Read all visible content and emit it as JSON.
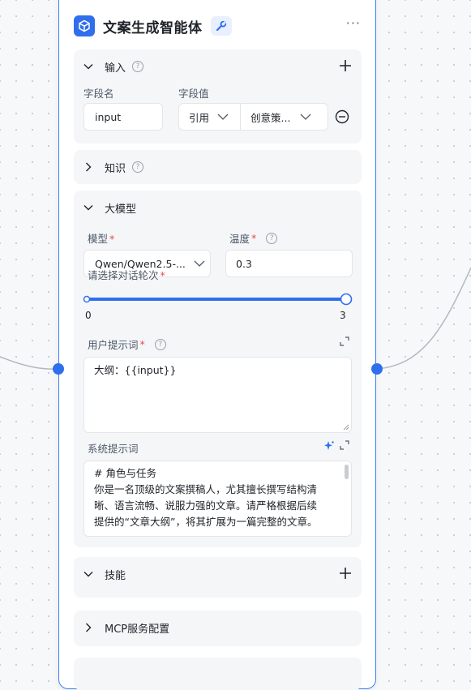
{
  "node": {
    "title": "文案生成智能体",
    "more_label": "···"
  },
  "input_section": {
    "title": "输入",
    "field_name_header": "字段名",
    "field_value_header": "字段值",
    "field_name_value": "input",
    "ref_type": "引用",
    "ref_value": "创意策..."
  },
  "knowledge_section": {
    "title": "知识"
  },
  "model_section": {
    "title": "大模型",
    "model_label": "模型",
    "model_value": "Qwen/Qwen2.5-...",
    "temperature_label": "温度",
    "temperature_value": "0.3",
    "rounds_label": "请选择对话轮次",
    "rounds_min": "0",
    "rounds_max": "3",
    "rounds_value": 3,
    "user_prompt_label": "用户提示词",
    "user_prompt_value": "大纲：{{input}}",
    "system_prompt_label": "系统提示词",
    "system_prompt_lines": [
      "# 角色与任务",
      "你是一名顶级的文案撰稿人，尤其擅长撰写结构清",
      "晰、语言流畅、说服力强的文章。请严格根据后续",
      "提供的“文章大纲”，将其扩展为一篇完整的文章。"
    ]
  },
  "skills_section": {
    "title": "技能"
  },
  "mcp_section": {
    "title": "MCP服务配置"
  },
  "colors": {
    "accent": "#2f6fed",
    "node_border": "#3b82f6",
    "required": "#e5484d"
  },
  "icons": {
    "app": "cube-icon",
    "wrench": "wrench-icon",
    "help": "help-circle-icon"
  }
}
